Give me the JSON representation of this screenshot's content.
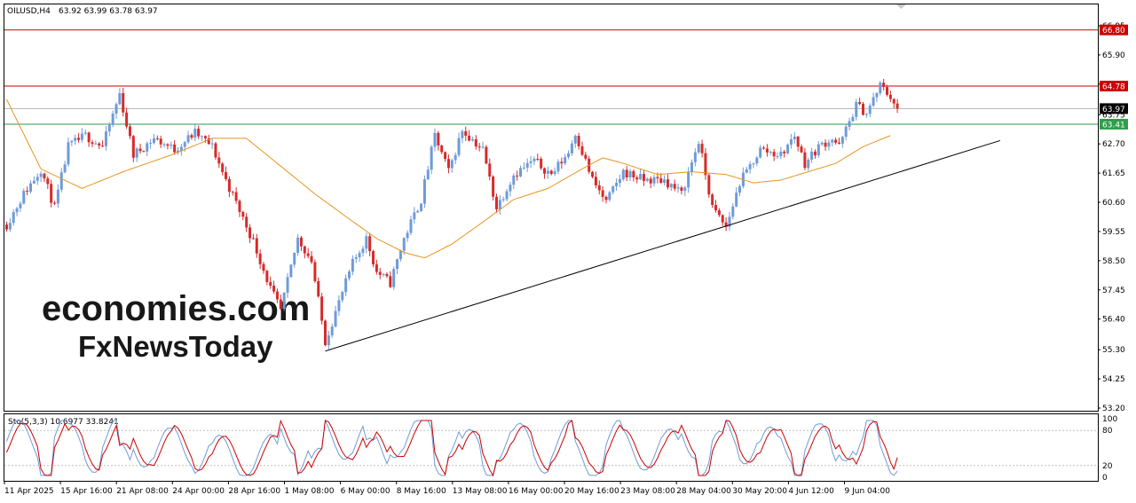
{
  "header": {
    "symbol": "OILUSD,H4",
    "ohlc": "63.92 63.99 63.78 63.97"
  },
  "watermark": {
    "line1": "economies.com",
    "line2": "FxNewsToday"
  },
  "chart_data": [
    {
      "type": "candlestick",
      "price_axis": {
        "ylim": [
          53.2,
          66.95
        ],
        "ticks": [
          "66.95",
          "65.90",
          "64.85",
          "63.75",
          "62.70",
          "61.65",
          "60.60",
          "59.55",
          "58.50",
          "57.45",
          "56.40",
          "55.30",
          "54.25",
          "53.20"
        ]
      },
      "price_labels": [
        {
          "text": "66.80",
          "value": 66.8,
          "color": "#cc0000",
          "line": "horizontal"
        },
        {
          "text": "64.78",
          "value": 64.78,
          "color": "#cc0000",
          "line": "horizontal"
        },
        {
          "text": "63.97",
          "value": 63.97,
          "color": "#000000",
          "line": "current-price"
        },
        {
          "text": "63.41",
          "value": 63.41,
          "color": "#2e9e4a",
          "line": "horizontal"
        }
      ],
      "x_axis": {
        "labels": [
          "11 Apr 2025",
          "15 Apr 16:00",
          "21 Apr 08:00",
          "24 Apr 00:00",
          "28 Apr 16:00",
          "1 May 08:00",
          "6 May 00:00",
          "8 May 16:00",
          "13 May 08:00",
          "16 May 00:00",
          "20 May 16:00",
          "23 May 08:00",
          "28 May 04:00",
          "30 May 20:00",
          "4 Jun 12:00",
          "9 Jun 04:00"
        ]
      },
      "path_keypoints": [
        [
          0,
          59.8
        ],
        [
          5,
          60.9
        ],
        [
          10,
          61.8
        ],
        [
          14,
          60.4
        ],
        [
          18,
          62.6
        ],
        [
          23,
          63.0
        ],
        [
          28,
          62.6
        ],
        [
          33,
          64.5
        ],
        [
          37,
          62.3
        ],
        [
          43,
          62.9
        ],
        [
          49,
          62.5
        ],
        [
          55,
          63.1
        ],
        [
          60,
          62.6
        ],
        [
          64,
          61.4
        ],
        [
          68,
          60.3
        ],
        [
          72,
          59.2
        ],
        [
          77,
          57.5
        ],
        [
          80,
          56.7
        ],
        [
          85,
          59.3
        ],
        [
          89,
          58.5
        ],
        [
          93,
          55.6
        ],
        [
          97,
          57.0
        ],
        [
          101,
          58.4
        ],
        [
          105,
          59.3
        ],
        [
          108,
          58.1
        ],
        [
          112,
          57.7
        ],
        [
          116,
          59.3
        ],
        [
          121,
          60.7
        ],
        [
          125,
          63.0
        ],
        [
          129,
          61.7
        ],
        [
          133,
          63.2
        ],
        [
          139,
          62.5
        ],
        [
          143,
          60.4
        ],
        [
          148,
          61.6
        ],
        [
          154,
          62.1
        ],
        [
          159,
          61.6
        ],
        [
          164,
          62.4
        ],
        [
          166,
          63.1
        ],
        [
          171,
          61.4
        ],
        [
          175,
          60.6
        ],
        [
          180,
          61.7
        ],
        [
          186,
          61.4
        ],
        [
          192,
          61.4
        ],
        [
          197,
          60.9
        ],
        [
          202,
          62.8
        ],
        [
          206,
          60.4
        ],
        [
          210,
          59.7
        ],
        [
          214,
          61.3
        ],
        [
          220,
          62.5
        ],
        [
          226,
          62.3
        ],
        [
          230,
          63.0
        ],
        [
          233,
          62.0
        ],
        [
          237,
          62.6
        ],
        [
          241,
          62.9
        ],
        [
          243,
          62.6
        ],
        [
          248,
          64.1
        ],
        [
          251,
          63.8
        ],
        [
          255,
          64.8
        ],
        [
          258,
          64.4
        ],
        [
          260,
          63.97
        ]
      ],
      "moving_average_keypoints": [
        [
          0,
          64.3
        ],
        [
          10,
          61.8
        ],
        [
          22,
          61.1
        ],
        [
          34,
          61.7
        ],
        [
          48,
          62.3
        ],
        [
          60,
          62.9
        ],
        [
          70,
          62.9
        ],
        [
          80,
          61.9
        ],
        [
          90,
          60.9
        ],
        [
          100,
          60.0
        ],
        [
          108,
          59.3
        ],
        [
          116,
          58.8
        ],
        [
          122,
          58.6
        ],
        [
          130,
          59.1
        ],
        [
          138,
          59.8
        ],
        [
          148,
          60.7
        ],
        [
          158,
          61.1
        ],
        [
          168,
          61.8
        ],
        [
          174,
          62.2
        ],
        [
          180,
          62.0
        ],
        [
          190,
          61.6
        ],
        [
          200,
          61.7
        ],
        [
          210,
          61.6
        ],
        [
          218,
          61.3
        ],
        [
          226,
          61.4
        ],
        [
          234,
          61.7
        ],
        [
          242,
          62.0
        ],
        [
          250,
          62.6
        ],
        [
          258,
          63.0
        ]
      ],
      "trendline": [
        [
          93,
          55.25
        ],
        [
          290,
          62.82
        ]
      ],
      "colors": {
        "up": "#6f9bd8",
        "down": "#d62b2b",
        "ma": "#e8951e",
        "trend": "#000000",
        "res": "#cc0000",
        "sup": "#2e9e4a"
      }
    },
    {
      "type": "line",
      "label": "Sto(5,3,3) 10.6977 33.8241",
      "ylim": [
        0,
        100
      ],
      "ticks": [
        "100",
        "80",
        "20",
        "0"
      ],
      "levels": [
        80,
        20
      ],
      "series": [
        {
          "name": "main",
          "color": "#6f9bd8",
          "amp": 0.95
        },
        {
          "name": "signal",
          "color": "#cc0000",
          "amp": 0.85
        }
      ],
      "last_values": {
        "main": 10.6977,
        "signal": 33.8241
      }
    }
  ]
}
